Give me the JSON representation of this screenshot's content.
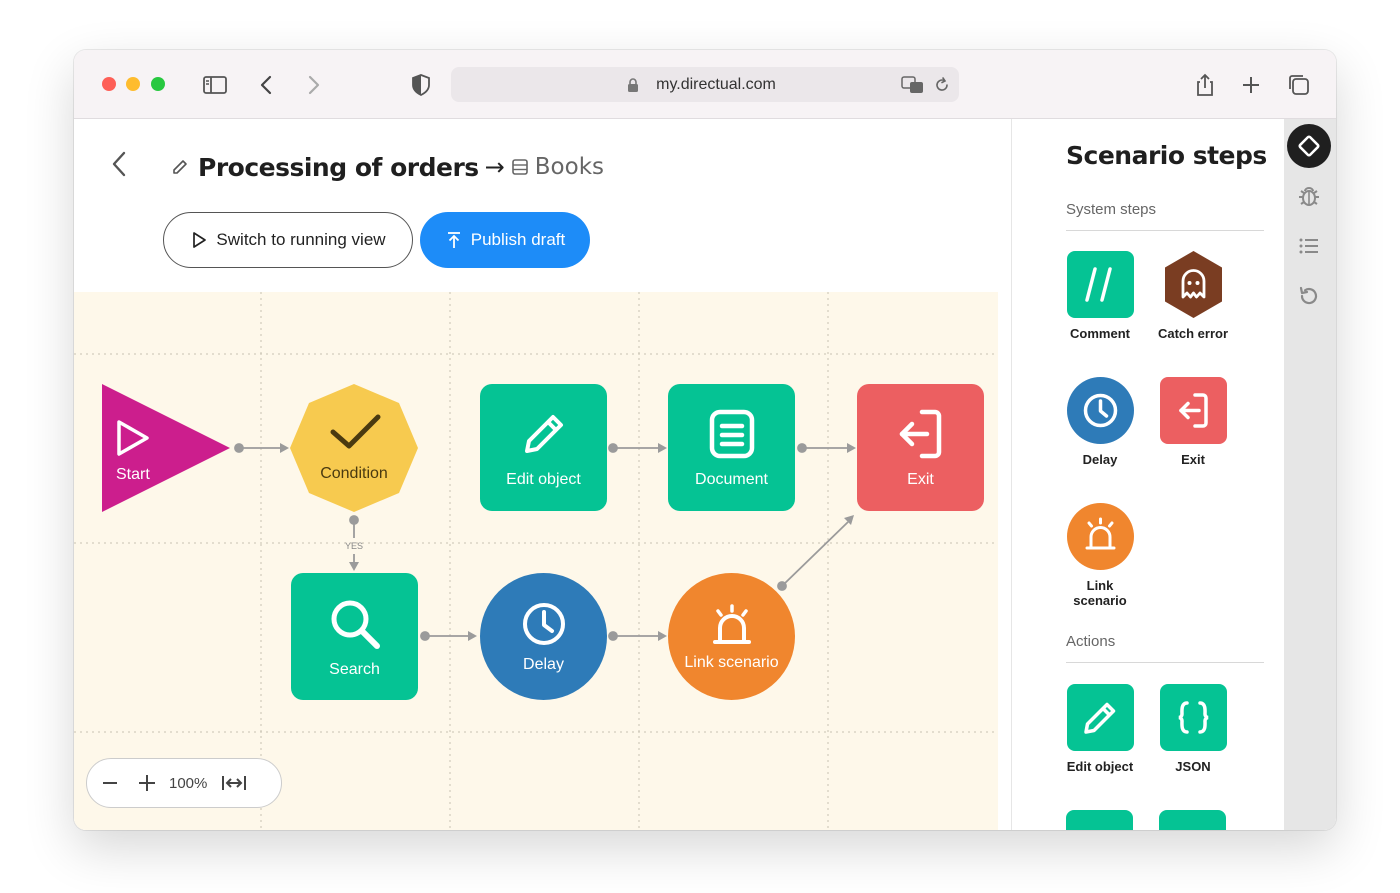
{
  "browser": {
    "url": "my.directual.com",
    "traffic_lights": {
      "close": "#fe5f57",
      "minimize": "#febc2e",
      "zoom": "#28c840"
    }
  },
  "header": {
    "title": "Processing of orders",
    "arrow": "→",
    "table_name": "Books",
    "switch_label": "Switch to running view",
    "publish_label": "Publish draft"
  },
  "canvas": {
    "nodes": {
      "start": "Start",
      "condition": "Condition",
      "edit_object": "Edit object",
      "document": "Document",
      "exit": "Exit",
      "search": "Search",
      "delay": "Delay",
      "link_scenario": "Link scenario"
    },
    "yes_label": "YES",
    "zoom_value": "100%"
  },
  "sidebar": {
    "title": "Scenario steps",
    "system_steps_title": "System steps",
    "actions_title": "Actions",
    "steps": {
      "comment": "Comment",
      "catch_error": "Catch error",
      "delay": "Delay",
      "exit": "Exit",
      "link_scenario": "Link scenario",
      "edit_object": "Edit object",
      "json": "JSON"
    }
  },
  "colors": {
    "green": "#05c394",
    "yellow": "#f7ca4f",
    "red": "#ec5f61",
    "magenta": "#cc1e8d",
    "blue": "#2e7bb8",
    "orange": "#f0862e",
    "brown": "#7a3d22",
    "accent": "#1d8cf8"
  }
}
